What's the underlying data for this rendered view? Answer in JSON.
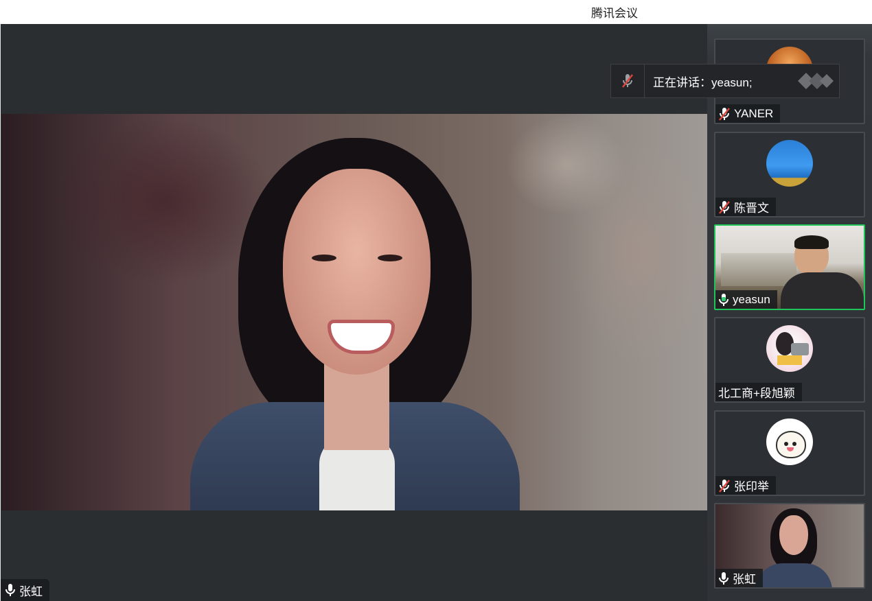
{
  "window": {
    "title": "腾讯会议"
  },
  "main": {
    "speaker_name": "张虹",
    "mic_state": "on"
  },
  "talking_banner": {
    "label": "正在讲话：yeasun;"
  },
  "participants": [
    {
      "name": "YANER",
      "mic": "muted",
      "avatar": "orange-photo-icon"
    },
    {
      "name": "陈晋文",
      "mic": "muted",
      "avatar": "blue-sky-photo-icon"
    },
    {
      "name": "yeasun",
      "mic": "speaking",
      "video": "camera-on",
      "active": true
    },
    {
      "name": "北工商+段旭颖",
      "mic": "none",
      "avatar": "cartoon-girl-laptop-icon"
    },
    {
      "name": "张印举",
      "mic": "muted",
      "avatar": "cartoon-bun-icon"
    },
    {
      "name": "张虹",
      "mic": "on",
      "video": "camera-on"
    }
  ],
  "colors": {
    "active_border": "#20c65a",
    "mic_speaking": "#2ecc71",
    "mic_muted": "#e0453c"
  }
}
